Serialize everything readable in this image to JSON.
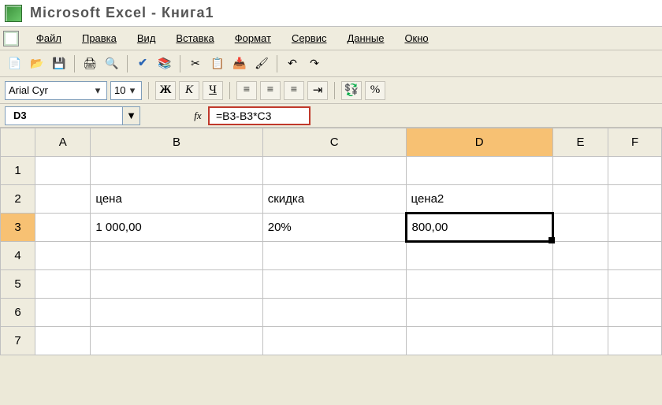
{
  "title": "Microsoft Excel - Книга1",
  "menus": [
    "Файл",
    "Правка",
    "Вид",
    "Вставка",
    "Формат",
    "Сервис",
    "Данные",
    "Окно"
  ],
  "font": {
    "name": "Arial Cyr",
    "size": "10"
  },
  "format_buttons": {
    "bold": "Ж",
    "italic": "К",
    "underline": "Ч"
  },
  "percent_label": "%",
  "name_box": "D3",
  "fx_label": "fx",
  "formula": "=B3-B3*C3",
  "columns": [
    "A",
    "B",
    "C",
    "D",
    "E",
    "F"
  ],
  "rows": [
    "1",
    "2",
    "3",
    "4",
    "5",
    "6",
    "7"
  ],
  "cells": {
    "B2": "цена",
    "C2": "скидка",
    "D2": "цена2",
    "B3": "1 000,00",
    "C3": "20%",
    "D3": "800,00"
  },
  "active_cell": "D3"
}
